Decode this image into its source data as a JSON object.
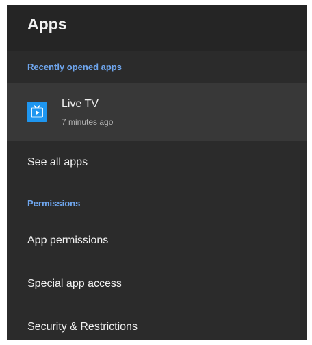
{
  "header": {
    "title": "Apps"
  },
  "sections": {
    "recent": {
      "label": "Recently opened apps",
      "items": [
        {
          "name": "Live TV",
          "opened": "7 minutes ago",
          "icon": "live-tv-icon",
          "icon_color": "#1e96f0"
        }
      ]
    },
    "see_all": "See all apps",
    "permissions": {
      "label": "Permissions",
      "items": [
        "App permissions",
        "Special app access",
        "Security & Restrictions"
      ]
    }
  },
  "colors": {
    "accent": "#6fa6ee",
    "background": "#2b2b2b",
    "header_background": "#252525",
    "focused_row": "#383838",
    "text": "#f1f1f1",
    "secondary_text": "#b5b5b5"
  }
}
